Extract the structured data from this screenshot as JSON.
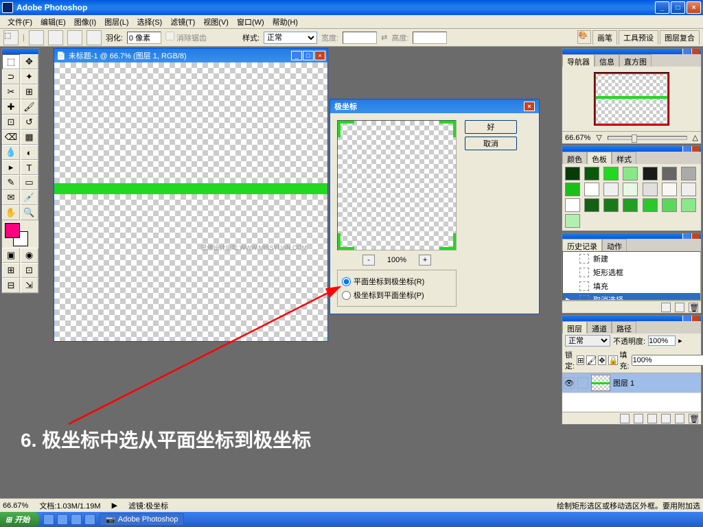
{
  "app": {
    "title": "Adobe Photoshop"
  },
  "menu": {
    "file": "文件(F)",
    "edit": "编辑(E)",
    "image": "图像(I)",
    "layer": "图层(L)",
    "select": "选择(S)",
    "filter": "滤镜(T)",
    "view": "视图(V)",
    "window": "窗口(W)",
    "help": "帮助(H)"
  },
  "options": {
    "feather_label": "羽化:",
    "feather_value": "0 像素",
    "antialias": "消除锯齿",
    "style_label": "样式:",
    "style_value": "正常",
    "width_label": "宽度:",
    "width_value": "",
    "height_label": "高度:",
    "height_value": "",
    "tabs": {
      "brushes": "画笔",
      "toolpresets": "工具预设",
      "layercomps": "图层复合"
    }
  },
  "document": {
    "title": "未标题-1 @ 66.7% (图层 1, RGB/8)",
    "watermark": "思缘设计论坛  WWW.MISSYUAN.COM"
  },
  "polar": {
    "title": "极坐标",
    "ok": "好",
    "cancel": "取消",
    "zoom": "100%",
    "option1": "平面坐标到极坐标(R)",
    "option2": "极坐标到平面坐标(P)"
  },
  "navigator": {
    "tabs": {
      "nav": "导航器",
      "info": "信息",
      "histo": "直方图"
    },
    "zoom": "66.67%"
  },
  "color": {
    "tabs": {
      "color": "颜色",
      "swatches": "色板",
      "styles": "样式"
    },
    "swatches": [
      "#0a3a0a",
      "#0a5a0a",
      "#22d822",
      "#88e888",
      "#1a1a1a",
      "#666",
      "#aaa",
      "#18c018",
      "#fff",
      "#f0f0f0",
      "#e8f8e8",
      "#e0e0e0",
      "#f8f8f0",
      "#eee",
      "#fff",
      "#146014",
      "#1a7a1a",
      "#22a022",
      "#2ac82a",
      "#5ad85a",
      "#8ae88a",
      "#b0f0b0"
    ]
  },
  "history": {
    "tabs": {
      "history": "历史记录",
      "actions": "动作"
    },
    "items": [
      {
        "label": "新建"
      },
      {
        "label": "矩形选框"
      },
      {
        "label": "填充"
      },
      {
        "label": "取消选择",
        "active": true
      }
    ]
  },
  "layers": {
    "tabs": {
      "layers": "图层",
      "channels": "通道",
      "paths": "路径"
    },
    "blend_value": "正常",
    "opacity_label": "不透明度:",
    "opacity_value": "100%",
    "lock_label": "锁定:",
    "fill_label": "填充:",
    "fill_value": "100%",
    "items": [
      {
        "name": "图层 1"
      }
    ]
  },
  "status": {
    "zoom": "66.67%",
    "docsize_label": "文档:",
    "docsize": "1.03M/1.19M",
    "filter_status": "滤镜:极坐标",
    "hint": "绘制矩形选区或移动选区外框。要用附加选"
  },
  "taskbar": {
    "start": "开始",
    "task1": "Adobe Photoshop"
  },
  "annotation": {
    "text": "6. 极坐标中选从平面坐标到极坐标"
  },
  "chart_data": null
}
